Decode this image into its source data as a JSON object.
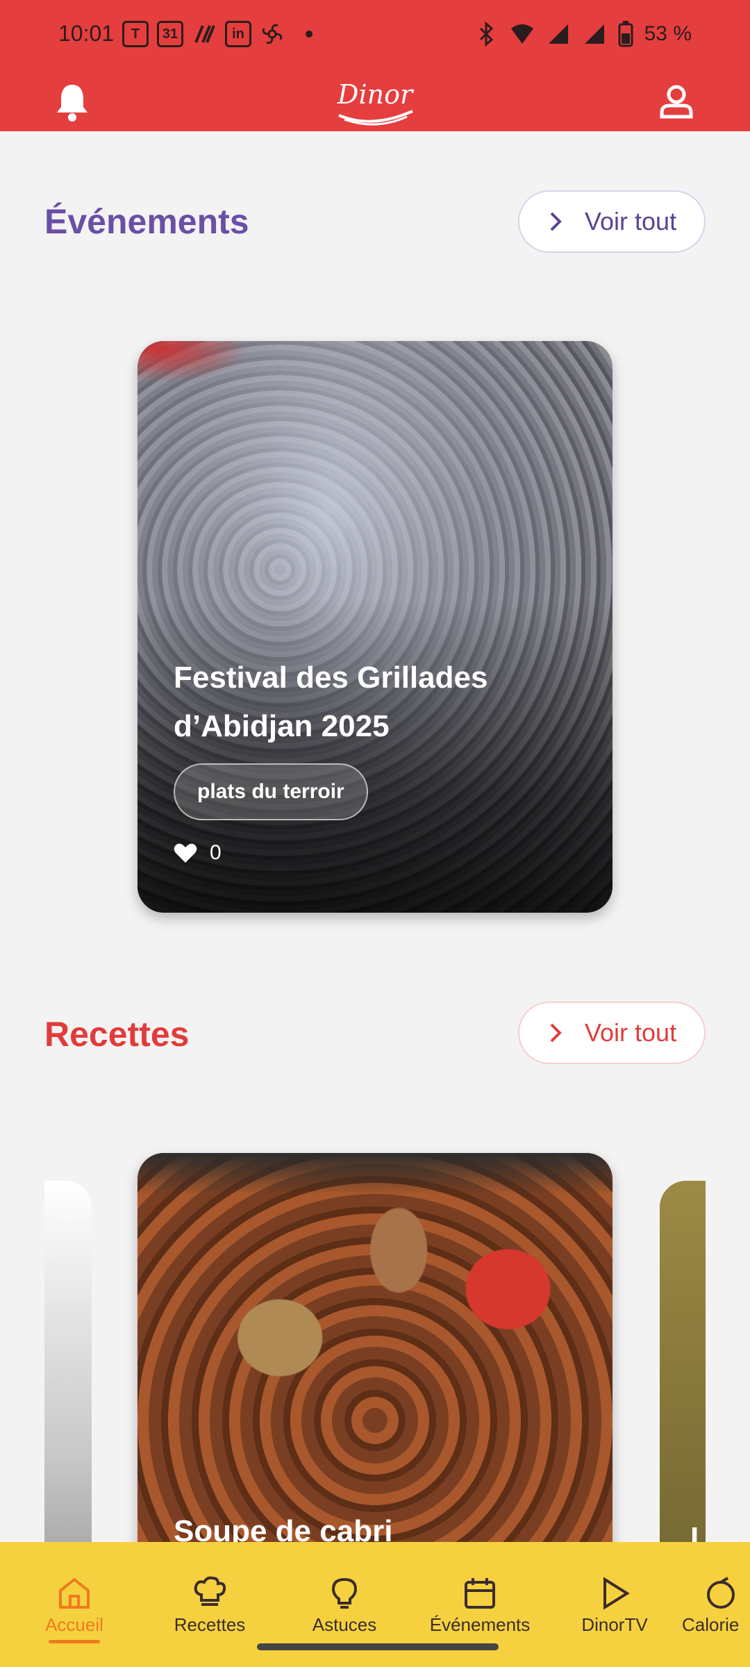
{
  "status_bar": {
    "time": "10:01",
    "calendar_day": "31",
    "battery": "53 %",
    "app_icons": [
      "teams-icon",
      "calendar-icon",
      "slash-icon",
      "linkedin-icon",
      "pinwheel-icon"
    ]
  },
  "header": {
    "brand": "Dinor",
    "bell_icon": "bell-icon",
    "user_icon": "user-icon"
  },
  "events_section": {
    "title": "Événements",
    "see_all": "Voir tout",
    "card": {
      "title": "Festival des Grillades d’Abidjan 2025",
      "tag": "plats du terroir",
      "likes": "0"
    }
  },
  "recipes_section": {
    "title": "Recettes",
    "see_all": "Voir tout",
    "card": {
      "title": "Soupe de cabri"
    },
    "next_card_initial": "L"
  },
  "bottom_nav": {
    "items": [
      {
        "label": "Accueil",
        "icon": "home-icon",
        "active": true
      },
      {
        "label": "Recettes",
        "icon": "chef-hat-icon"
      },
      {
        "label": "Astuces",
        "icon": "lightbulb-icon"
      },
      {
        "label": "Événements",
        "icon": "calendar-icon"
      },
      {
        "label": "DinorTV",
        "icon": "play-icon"
      },
      {
        "label": "Calorie",
        "icon": "calorie-icon"
      }
    ]
  },
  "colors": {
    "header_red": "#e53e3e",
    "events_purple": "#6a4fa6",
    "recipes_red": "#e23b3b",
    "nav_yellow": "#f6d13f",
    "active_orange": "#f07a1f"
  }
}
